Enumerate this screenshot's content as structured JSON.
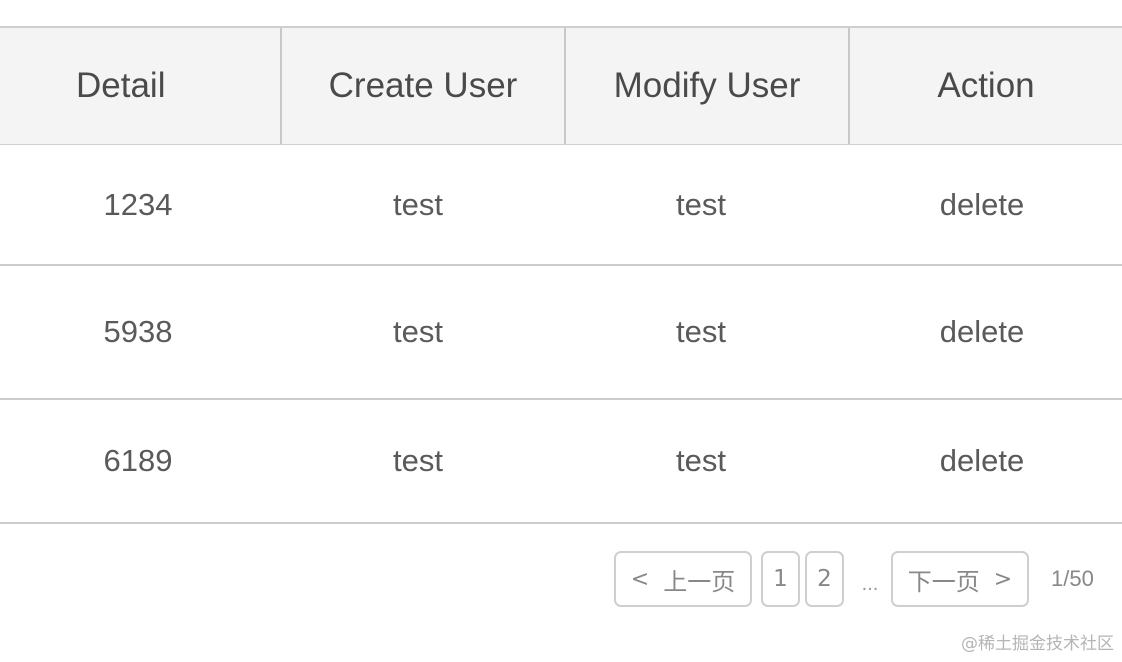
{
  "table": {
    "columns": [
      "Detail",
      "Create User",
      "Modify User",
      "Action"
    ],
    "rows": [
      [
        "1234",
        "test",
        "test",
        "delete"
      ],
      [
        "5938",
        "test",
        "test",
        "delete"
      ],
      [
        "6189",
        "test",
        "test",
        "delete"
      ]
    ]
  },
  "pagination": {
    "prev_arrow": "<",
    "prev_label": "上一页",
    "pages": [
      "1",
      "2"
    ],
    "ellipsis": "...",
    "next_label": "下一页",
    "next_arrow": ">",
    "total": "1/50"
  },
  "watermark": "@稀土掘金技术社区"
}
